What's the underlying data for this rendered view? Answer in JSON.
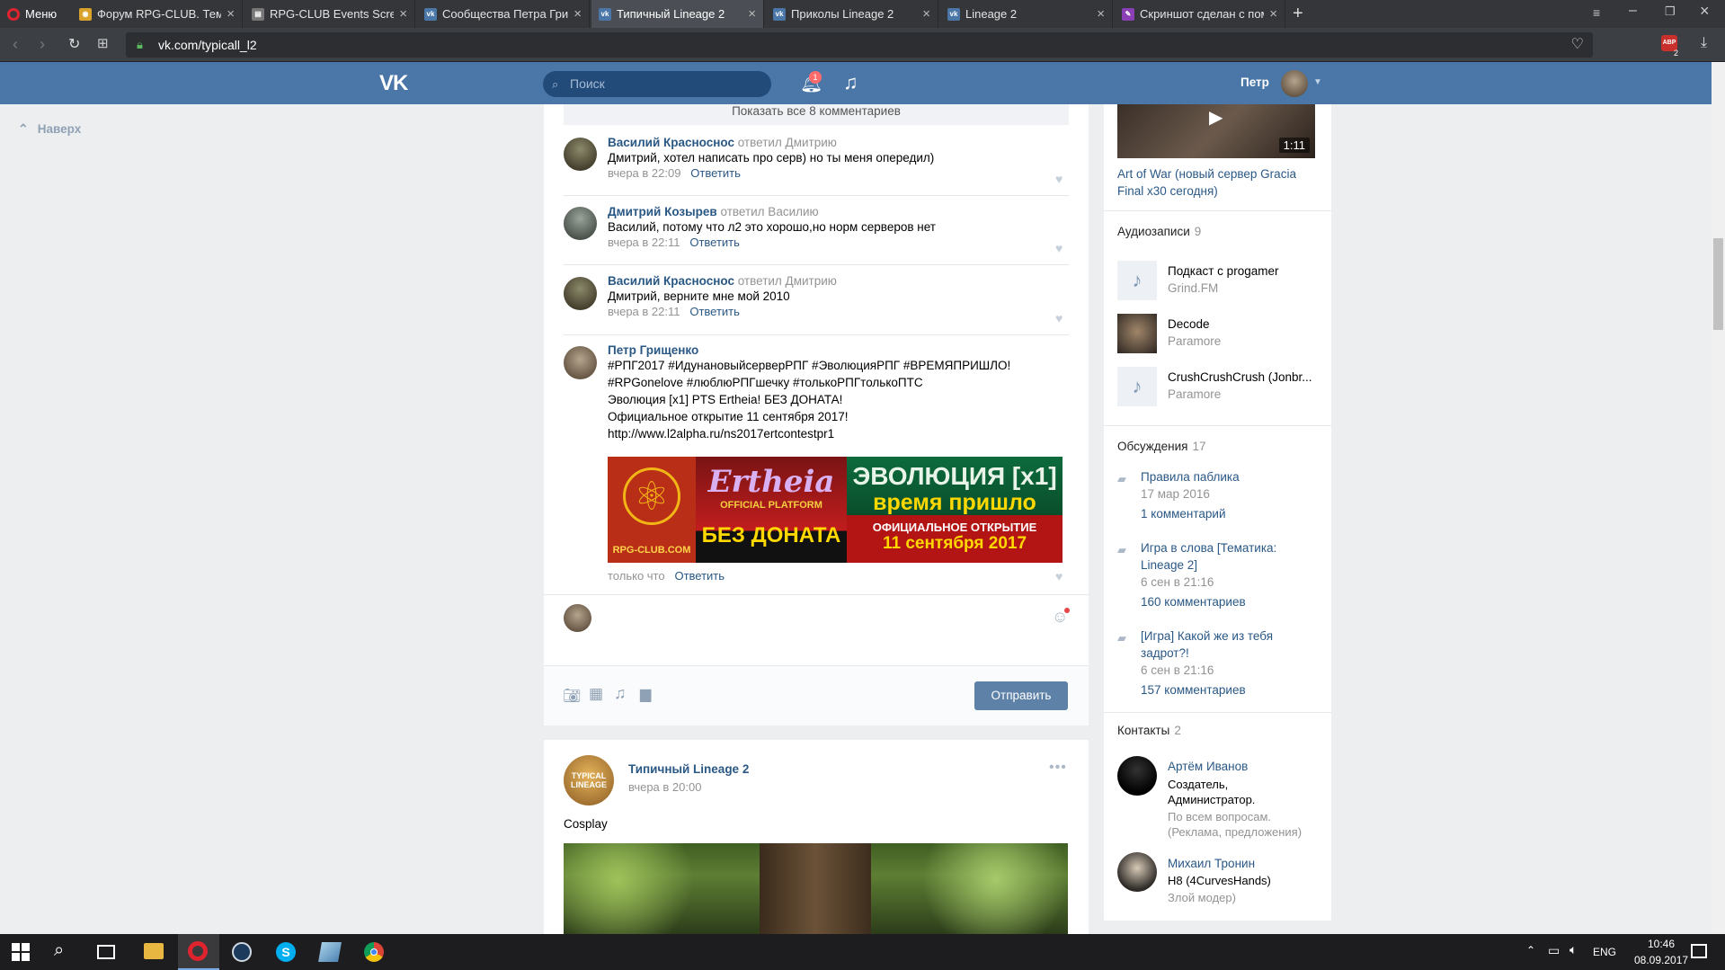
{
  "browser": {
    "menu_label": "Меню",
    "tabs": [
      {
        "title": "Форум RPG-CLUB. Тема: Г",
        "favicon": "rpg-club-icon",
        "active": false
      },
      {
        "title": "RPG-CLUB Events Screensh",
        "favicon": "page-icon",
        "active": false
      },
      {
        "title": "Сообщества Петра Грищ",
        "favicon": "vk-icon",
        "active": false
      },
      {
        "title": "Типичный Lineage 2",
        "favicon": "vk-icon",
        "active": true
      },
      {
        "title": "Приколы Lineage 2",
        "favicon": "vk-icon",
        "active": false
      },
      {
        "title": "Lineage 2",
        "favicon": "vk-icon",
        "active": false
      },
      {
        "title": "Скриншот сделан с помо",
        "favicon": "feather-icon",
        "active": false
      }
    ],
    "url": "vk.com/typicall_l2",
    "adblock_count": "2"
  },
  "vk_header": {
    "search_placeholder": "Поиск",
    "notifications_count": "1",
    "user_name": "Петр"
  },
  "back_to_top": "Наверх",
  "post1": {
    "show_all_comments": "Показать все 8 комментариев",
    "reply_label": "Ответить",
    "comments": [
      {
        "author": "Василий Красноснос",
        "replied_to": "ответил Дмитрию",
        "text": "Дмитрий, хотел написать про серв) но ты меня опередил)",
        "time": "вчера в 22:09"
      },
      {
        "author": "Дмитрий Козырев",
        "replied_to": "ответил Василию",
        "text": "Василий, потому что л2 это хорошо,но норм серверов нет",
        "time": "вчера в 22:11"
      },
      {
        "author": "Василий Красноснос",
        "replied_to": "ответил Дмитрию",
        "text": "Дмитрий, верните мне мой 2010",
        "time": "вчера в 22:11"
      }
    ],
    "own_comment": {
      "author": "Петр Грищенко",
      "hashtags_line1": "#РПГ2017 #ИдунановыйсерверРПГ #ЭволюцияРПГ #ВРЕМЯПРИШЛО!",
      "hashtags_line2": "#RPGonelove #люблюРПГшечку #толькоРПГтолькоПТС",
      "line3": "Эволюция [x1] PTS Ertheia! БЕЗ ДОНАТА!",
      "line4": "Официальное открытие 11 сентября 2017!",
      "link": "http://www.l2alpha.ru/ns2017ertcontestpr1",
      "time": "только что"
    },
    "banner": {
      "logo_text": "RPG-CLUB.COM",
      "brand": "Ertheia",
      "brand_sub": "OFFICIAL PLATFORM",
      "no_donate": "БЕЗ ДОНАТА",
      "evo": "ЭВОЛЮЦИЯ [x1]",
      "time_came": "время пришло",
      "opening": "ОФИЦИАЛЬНОЕ ОТКРЫТИЕ",
      "date": "11 сентября 2017"
    },
    "send_button": "Отправить"
  },
  "post2": {
    "author": "Типичный Lineage 2",
    "avatar_text": "TYPICAL LINEAGE",
    "time": "вчера в 20:00",
    "text": "Cosplay"
  },
  "sidebar": {
    "video": {
      "duration": "1:11",
      "title": "Art of War (новый сервер Gracia Final x30 сегодня)"
    },
    "audio": {
      "title": "Аудиозаписи",
      "count": "9",
      "items": [
        {
          "title": "Подкаст с progamer",
          "artist": "Grind.FM"
        },
        {
          "title": "Decode",
          "artist": "Paramore"
        },
        {
          "title": "CrushCrushCrush (Jonbr...",
          "artist": "Paramore"
        }
      ]
    },
    "discussions": {
      "title": "Обсуждения",
      "count": "17",
      "items": [
        {
          "title": "Правила паблика",
          "date": "17 мар 2016",
          "comments": "1 комментарий"
        },
        {
          "title": "Игра в слова [Тематика: Lineage 2]",
          "date": "6 сен в 21:16",
          "comments": "160 комментариев"
        },
        {
          "title": "[Игра] Какой же из тебя задрот?!",
          "date": "6 сен в 21:16",
          "comments": "157 комментариев"
        }
      ]
    },
    "contacts": {
      "title": "Контакты",
      "count": "2",
      "items": [
        {
          "name": "Артём Иванов",
          "role": "Создатель, Администратор.",
          "note": "По всем вопросам. (Реклама, предложения)"
        },
        {
          "name": "Михаил Тронин",
          "role": "H8 (4CurvesHands)",
          "note": "Злой модер)"
        }
      ]
    }
  },
  "taskbar": {
    "lang": "ENG",
    "time": "10:46",
    "date": "08.09.2017"
  },
  "colors": {
    "vk_blue": "#4a76a8",
    "link": "#2a5885",
    "page_bg": "#edeef0"
  }
}
